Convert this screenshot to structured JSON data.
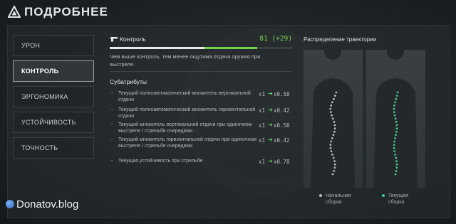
{
  "header": {
    "title": "ПОДРОБНЕЕ"
  },
  "tabs": [
    {
      "label": "УРОН",
      "active": false
    },
    {
      "label": "КОНТРОЛЬ",
      "active": true
    },
    {
      "label": "ЭРГОНОМИКА",
      "active": false
    },
    {
      "label": "УСТОЙЧИВОСТЬ",
      "active": false
    },
    {
      "label": "ТОЧНОСТЬ",
      "active": false
    }
  ],
  "stat": {
    "name": "Контроль",
    "value": "81 (+29)",
    "base_fraction": 0.52,
    "total_fraction": 0.81,
    "description": "Чем выше контроль, тем менее ощутима отдача оружия при выстреле."
  },
  "subattributes": {
    "title": "Субатрибуты",
    "rows": [
      {
        "bullet": "-",
        "label": "Текущий полноавтоматический множитель вертикальной отдачи",
        "from": "x1",
        "arrow": "➜",
        "to": "x0.58"
      },
      {
        "bullet": "-",
        "label": "Текущий полноавтоматический множитель горизонтальной отдачи",
        "from": "x1",
        "arrow": "➜",
        "to": "x0.42"
      },
      {
        "bullet": "-",
        "label": "Текущий множитель вертикальной отдачи при одиночном выстреле / стрельбе очередями",
        "from": "x1",
        "arrow": "➜",
        "to": "x0.58"
      },
      {
        "bullet": "-",
        "label": "Текущий множитель горизонтальной отдачи при одиночном выстреле / стрельбе очередями",
        "from": "x1",
        "arrow": "➜",
        "to": "x0.42"
      },
      {
        "bullet": "-",
        "label": "Текущая устойчивость при стрельбе",
        "from": "x1",
        "arrow": "➜",
        "to": "x0.78"
      }
    ]
  },
  "trajectory": {
    "title": "Распределение траектории",
    "legend": [
      {
        "label": "Начальная сборка",
        "color": "#b5b9bb"
      },
      {
        "label": "Текущая сборка",
        "color": "#3cc98a"
      }
    ]
  },
  "watermark": "Donatov.blog",
  "colors": {
    "accent_green": "#6fd44a",
    "arrow_green": "#5fcf6a",
    "trajectory_green": "#3cc98a"
  }
}
